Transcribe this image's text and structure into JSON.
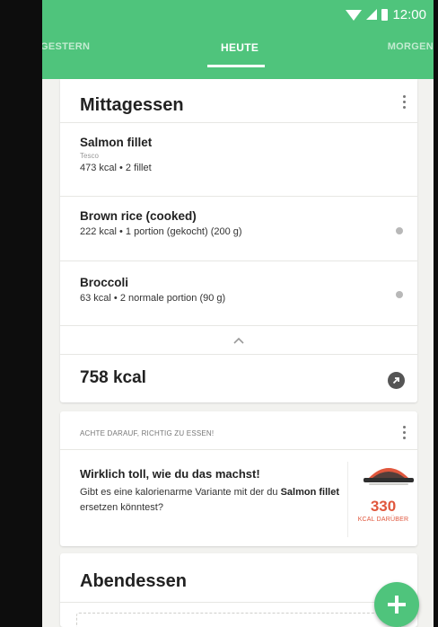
{
  "status_bar": {
    "time": "12:00",
    "icons": [
      "wifi-icon",
      "signal-icon",
      "battery-icon"
    ]
  },
  "tabs": {
    "previous": "GESTERN",
    "current": "HEUTE",
    "next": "MORGEN"
  },
  "lunch": {
    "title": "Mittagessen",
    "items": [
      {
        "name": "Salmon fillet",
        "brand": "Tesco",
        "description": "473 kcal • 2 fillet"
      },
      {
        "name": "Brown rice (cooked)",
        "description": "222 kcal • 1 portion (gekocht) (200 g)"
      },
      {
        "name": "Broccoli",
        "description": "63 kcal • 2 normale portion (90 g)"
      }
    ],
    "total": "758 kcal"
  },
  "tip": {
    "label": "ACHTE DARAUF, RICHTIG ZU ESSEN!",
    "headline": "Wirklich toll, wie du das machst!",
    "body_before": "Gibt es eine kalorienarme Variante mit der du",
    "body_food": "Salmon fillet",
    "body_after": "ersetzen könntest?",
    "over_value": "330",
    "over_label": "KCAL DARÜBER"
  },
  "dinner": {
    "title": "Abendessen"
  },
  "colors": {
    "primary": "#4fc47c",
    "accent_red": "#e0573d",
    "background": "#f2f2ef"
  }
}
